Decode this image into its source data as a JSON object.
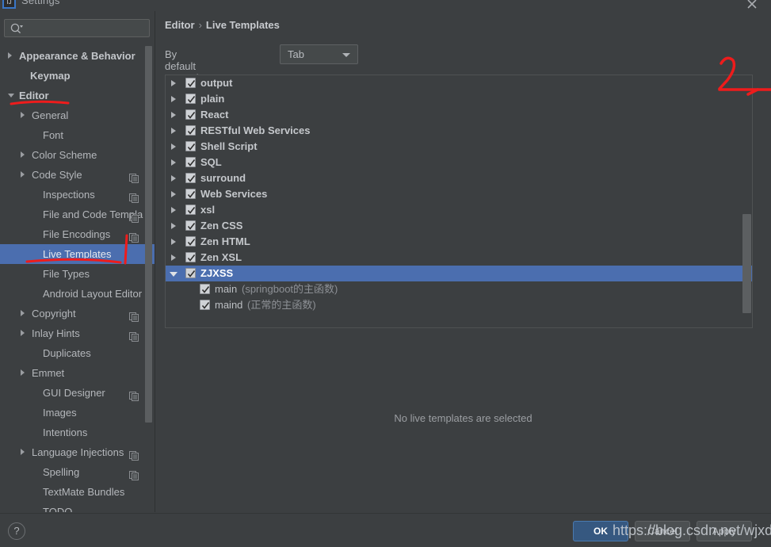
{
  "window": {
    "title": "Settings",
    "icon": "settings-app-icon",
    "close_icon": "close-icon"
  },
  "search": {
    "placeholder": "",
    "value": "",
    "icon": "search-icon"
  },
  "sidebar": {
    "items": [
      {
        "label": "Appearance & Behavior",
        "arrow": "collapsed",
        "indent": 10,
        "bold": true,
        "copy": false,
        "selected": false
      },
      {
        "label": "Keymap",
        "arrow": "none",
        "indent": 24,
        "bold": true,
        "copy": false,
        "selected": false
      },
      {
        "label": "Editor",
        "arrow": "expanded",
        "indent": 10,
        "bold": true,
        "copy": false,
        "selected": false
      },
      {
        "label": "General",
        "arrow": "collapsed",
        "indent": 26,
        "bold": false,
        "copy": false,
        "selected": false
      },
      {
        "label": "Font",
        "arrow": "none",
        "indent": 40,
        "bold": false,
        "copy": false,
        "selected": false
      },
      {
        "label": "Color Scheme",
        "arrow": "collapsed",
        "indent": 26,
        "bold": false,
        "copy": false,
        "selected": false
      },
      {
        "label": "Code Style",
        "arrow": "collapsed",
        "indent": 26,
        "bold": false,
        "copy": true,
        "selected": false
      },
      {
        "label": "Inspections",
        "arrow": "none",
        "indent": 40,
        "bold": false,
        "copy": true,
        "selected": false
      },
      {
        "label": "File and Code Templa",
        "arrow": "none",
        "indent": 40,
        "bold": false,
        "copy": true,
        "selected": false
      },
      {
        "label": "File Encodings",
        "arrow": "none",
        "indent": 40,
        "bold": false,
        "copy": true,
        "selected": false
      },
      {
        "label": "Live Templates",
        "arrow": "none",
        "indent": 40,
        "bold": false,
        "copy": false,
        "selected": true
      },
      {
        "label": "File Types",
        "arrow": "none",
        "indent": 40,
        "bold": false,
        "copy": false,
        "selected": false
      },
      {
        "label": "Android Layout Editor",
        "arrow": "none",
        "indent": 40,
        "bold": false,
        "copy": false,
        "selected": false
      },
      {
        "label": "Copyright",
        "arrow": "collapsed",
        "indent": 26,
        "bold": false,
        "copy": true,
        "selected": false
      },
      {
        "label": "Inlay Hints",
        "arrow": "collapsed",
        "indent": 26,
        "bold": false,
        "copy": true,
        "selected": false
      },
      {
        "label": "Duplicates",
        "arrow": "none",
        "indent": 40,
        "bold": false,
        "copy": false,
        "selected": false
      },
      {
        "label": "Emmet",
        "arrow": "collapsed",
        "indent": 26,
        "bold": false,
        "copy": false,
        "selected": false
      },
      {
        "label": "GUI Designer",
        "arrow": "none",
        "indent": 40,
        "bold": false,
        "copy": true,
        "selected": false
      },
      {
        "label": "Images",
        "arrow": "none",
        "indent": 40,
        "bold": false,
        "copy": false,
        "selected": false
      },
      {
        "label": "Intentions",
        "arrow": "none",
        "indent": 40,
        "bold": false,
        "copy": false,
        "selected": false
      },
      {
        "label": "Language Injections",
        "arrow": "collapsed",
        "indent": 26,
        "bold": false,
        "copy": true,
        "selected": false
      },
      {
        "label": "Spelling",
        "arrow": "none",
        "indent": 40,
        "bold": false,
        "copy": true,
        "selected": false
      },
      {
        "label": "TextMate Bundles",
        "arrow": "none",
        "indent": 40,
        "bold": false,
        "copy": false,
        "selected": false
      },
      {
        "label": "TODO",
        "arrow": "none",
        "indent": 40,
        "bold": false,
        "copy": false,
        "selected": false
      }
    ]
  },
  "main": {
    "breadcrumb": {
      "parent": "Editor",
      "separator": "›",
      "current": "Live Templates"
    },
    "expand_with": {
      "label": "By default expand with",
      "value": "Tab"
    },
    "templates": [
      {
        "name": "output",
        "checked": true,
        "expanded": false,
        "child": false,
        "desc": ""
      },
      {
        "name": "plain",
        "checked": true,
        "expanded": false,
        "child": false,
        "desc": ""
      },
      {
        "name": "React",
        "checked": true,
        "expanded": false,
        "child": false,
        "desc": ""
      },
      {
        "name": "RESTful Web Services",
        "checked": true,
        "expanded": false,
        "child": false,
        "desc": ""
      },
      {
        "name": "Shell Script",
        "checked": true,
        "expanded": false,
        "child": false,
        "desc": ""
      },
      {
        "name": "SQL",
        "checked": true,
        "expanded": false,
        "child": false,
        "desc": ""
      },
      {
        "name": "surround",
        "checked": true,
        "expanded": false,
        "child": false,
        "desc": ""
      },
      {
        "name": "Web Services",
        "checked": true,
        "expanded": false,
        "child": false,
        "desc": ""
      },
      {
        "name": "xsl",
        "checked": true,
        "expanded": false,
        "child": false,
        "desc": ""
      },
      {
        "name": "Zen CSS",
        "checked": true,
        "expanded": false,
        "child": false,
        "desc": ""
      },
      {
        "name": "Zen HTML",
        "checked": true,
        "expanded": false,
        "child": false,
        "desc": ""
      },
      {
        "name": "Zen XSL",
        "checked": true,
        "expanded": false,
        "child": false,
        "desc": ""
      },
      {
        "name": "ZJXSS",
        "checked": true,
        "expanded": true,
        "child": false,
        "desc": "",
        "selected": true
      },
      {
        "name": "main",
        "checked": true,
        "expanded": false,
        "child": true,
        "desc": "(springboot的主函数)"
      },
      {
        "name": "maind",
        "checked": true,
        "expanded": false,
        "child": true,
        "desc": "(正常的主函数)"
      }
    ],
    "toolbar": [
      {
        "icon": "plus-icon",
        "name": "add-template-button"
      },
      {
        "icon": "minus-icon",
        "name": "remove-template-button"
      },
      {
        "icon": "copy-icon",
        "name": "duplicate-template-button"
      },
      {
        "icon": "undo-icon",
        "name": "restore-defaults-button"
      }
    ],
    "placeholder_text": "No live templates are selected"
  },
  "footer": {
    "help_label": "?",
    "ok_label": "OK",
    "cancel_label": "Cancel",
    "apply_label": "Apply"
  },
  "annotations": {
    "marker_2": "2",
    "color": "#ee1c1c",
    "watermark": "https://blog.csdn.net/wjxds"
  }
}
